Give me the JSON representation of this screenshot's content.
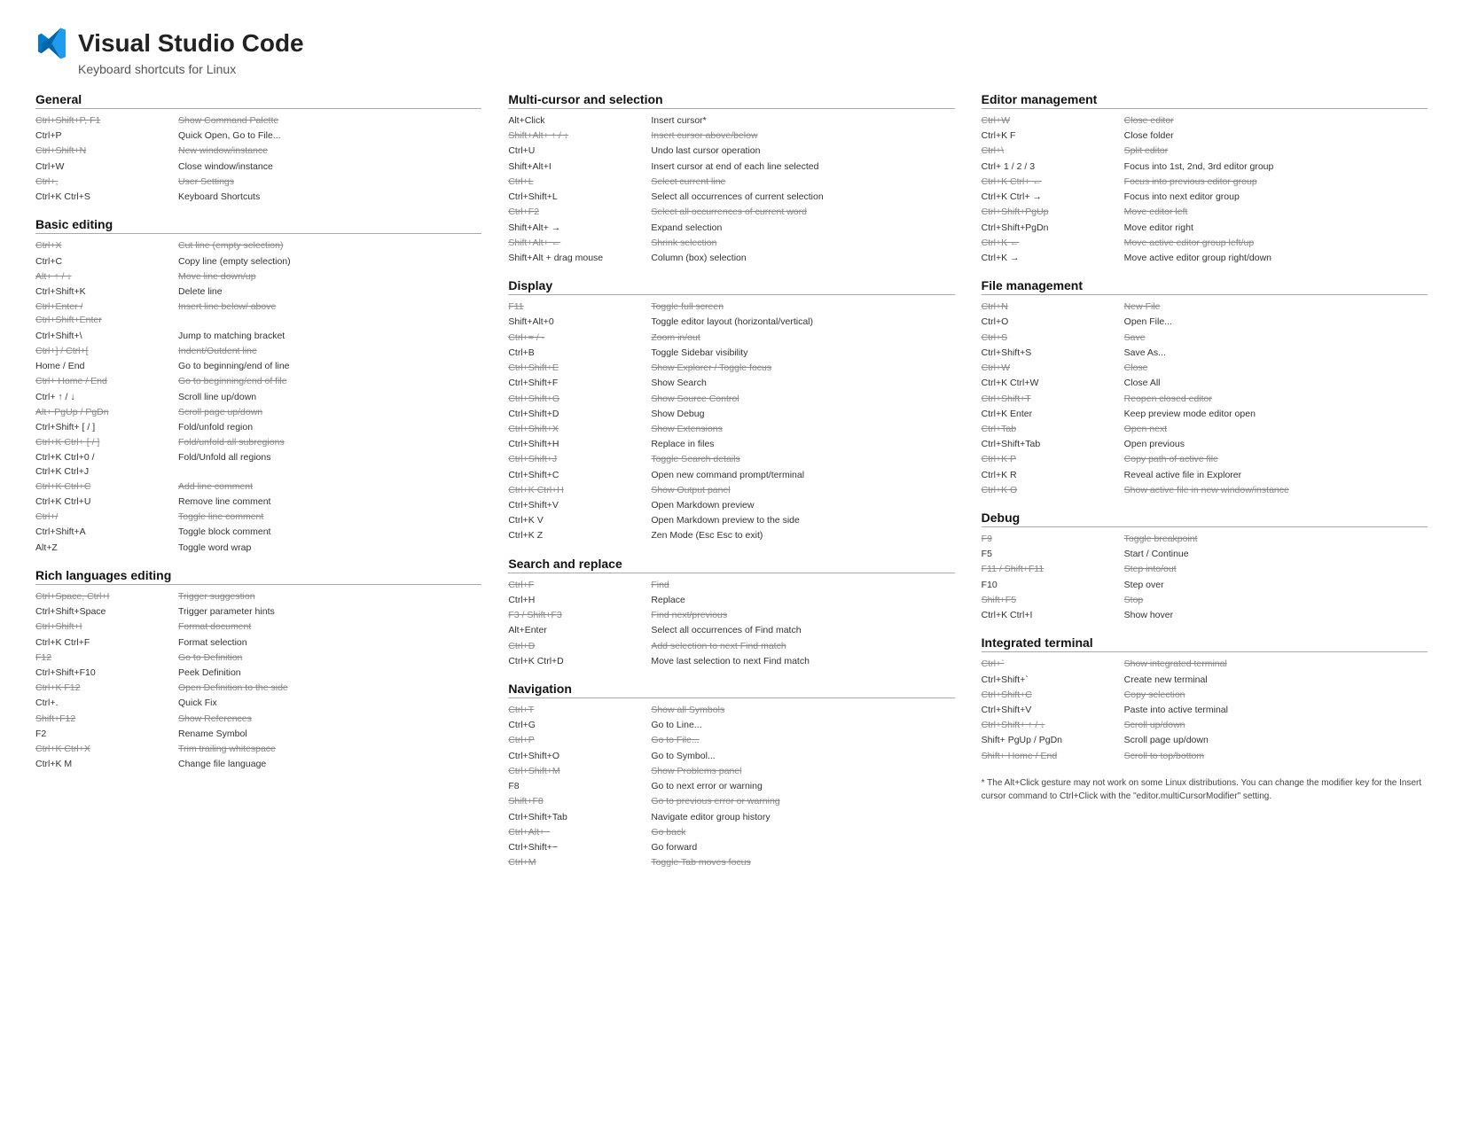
{
  "header": {
    "title": "Visual Studio Code",
    "subtitle": "Keyboard shortcuts for Linux"
  },
  "sections": {
    "general": {
      "title": "General",
      "items": [
        {
          "key": "Ctrl+Shift+P, F1",
          "desc": "Show Command Palette",
          "strike": true
        },
        {
          "key": "Ctrl+P",
          "desc": "Quick Open, Go to File..."
        },
        {
          "key": "Ctrl+Shift+N",
          "desc": "New window/instance",
          "strike": true
        },
        {
          "key": "Ctrl+W",
          "desc": "Close window/instance"
        },
        {
          "key": "Ctrl+,",
          "desc": "User Settings",
          "strike": true
        },
        {
          "key": "Ctrl+K Ctrl+S",
          "desc": "Keyboard Shortcuts"
        }
      ]
    },
    "basic_editing": {
      "title": "Basic editing",
      "items": [
        {
          "key": "Ctrl+X",
          "desc": "Cut line (empty selection)",
          "strike": true
        },
        {
          "key": "Ctrl+C",
          "desc": "Copy line (empty selection)"
        },
        {
          "key": "Alt+ ↑ / ↓",
          "desc": "Move line down/up",
          "strike": true
        },
        {
          "key": "Ctrl+Shift+K",
          "desc": "Delete line"
        },
        {
          "key": "Ctrl+Enter /\nCtrl+Shift+Enter",
          "desc": "Insert line below/ above",
          "strike": true
        },
        {
          "key": "Ctrl+Shift+\\",
          "desc": "Jump to matching bracket"
        },
        {
          "key": "Ctrl+] / Ctrl+[",
          "desc": "Indent/Outdent line",
          "strike": true
        },
        {
          "key": "Home / End",
          "desc": "Go to beginning/end of line"
        },
        {
          "key": "Ctrl+ Home / End",
          "desc": "Go to beginning/end of file",
          "strike": true
        },
        {
          "key": "Ctrl+ ↑ / ↓",
          "desc": "Scroll line up/down"
        },
        {
          "key": "Alt+ PgUp / PgDn",
          "desc": "Scroll page up/down",
          "strike": true
        },
        {
          "key": "Ctrl+Shift+ [ / ]",
          "desc": "Fold/unfold region"
        },
        {
          "key": "Ctrl+K Ctrl+ [ / ]",
          "desc": "Fold/unfold all subregions",
          "strike": true
        },
        {
          "key": "Ctrl+K Ctrl+0 /\nCtrl+K Ctrl+J",
          "desc": "Fold/Unfold all regions"
        },
        {
          "key": "Ctrl+K Ctrl+C",
          "desc": "Add line comment",
          "strike": true
        },
        {
          "key": "Ctrl+K Ctrl+U",
          "desc": "Remove line comment"
        },
        {
          "key": "Ctrl+/",
          "desc": "Toggle line comment",
          "strike": true
        },
        {
          "key": "Ctrl+Shift+A",
          "desc": "Toggle block comment"
        },
        {
          "key": "Alt+Z",
          "desc": "Toggle word wrap"
        }
      ]
    },
    "rich_languages": {
      "title": "Rich languages editing",
      "items": [
        {
          "key": "Ctrl+Space, Ctrl+I",
          "desc": "Trigger suggestion",
          "strike": true
        },
        {
          "key": "Ctrl+Shift+Space",
          "desc": "Trigger parameter hints"
        },
        {
          "key": "Ctrl+Shift+I",
          "desc": "Format document",
          "strike": true
        },
        {
          "key": "Ctrl+K Ctrl+F",
          "desc": "Format selection"
        },
        {
          "key": "F12",
          "desc": "Go to Definition",
          "strike": true
        },
        {
          "key": "Ctrl+Shift+F10",
          "desc": "Peek Definition"
        },
        {
          "key": "Ctrl+K F12",
          "desc": "Open Definition to the side",
          "strike": true
        },
        {
          "key": "Ctrl+.",
          "desc": "Quick Fix"
        },
        {
          "key": "Shift+F12",
          "desc": "Show References",
          "strike": true
        },
        {
          "key": "F2",
          "desc": "Rename Symbol"
        },
        {
          "key": "Ctrl+K Ctrl+X",
          "desc": "Trim trailing whitespace",
          "strike": true
        },
        {
          "key": "Ctrl+K M",
          "desc": "Change file language"
        }
      ]
    },
    "multi_cursor": {
      "title": "Multi-cursor and selection",
      "items": [
        {
          "key": "Alt+Click",
          "desc": "Insert cursor*"
        },
        {
          "key": "Shift+Alt+ ↑ / ↓",
          "desc": "Insert cursor above/below",
          "strike": true
        },
        {
          "key": "Ctrl+U",
          "desc": "Undo last cursor operation"
        },
        {
          "key": "Shift+Alt+I",
          "desc": "Insert cursor at end of each line selected"
        },
        {
          "key": "Ctrl+L",
          "desc": "Select current line",
          "strike": true
        },
        {
          "key": "Ctrl+Shift+L",
          "desc": "Select all occurrences of current selection"
        },
        {
          "key": "Ctrl+F2",
          "desc": "Select all occurrences of current word",
          "strike": true
        },
        {
          "key": "Shift+Alt+ →",
          "desc": "Expand selection"
        },
        {
          "key": "Shift+Alt+ ←",
          "desc": "Shrink selection",
          "strike": true
        },
        {
          "key": "Shift+Alt + drag mouse",
          "desc": "Column (box) selection"
        }
      ]
    },
    "display": {
      "title": "Display",
      "items": [
        {
          "key": "F11",
          "desc": "Toggle full screen",
          "strike": true
        },
        {
          "key": "Shift+Alt+0",
          "desc": "Toggle editor layout (horizontal/vertical)"
        },
        {
          "key": "Ctrl+= / -",
          "desc": "Zoom in/out",
          "strike": true
        },
        {
          "key": "Ctrl+B",
          "desc": "Toggle Sidebar visibility"
        },
        {
          "key": "Ctrl+Shift+E",
          "desc": "Show Explorer / Toggle focus",
          "strike": true
        },
        {
          "key": "Ctrl+Shift+F",
          "desc": "Show Search"
        },
        {
          "key": "Ctrl+Shift+G",
          "desc": "Show Source Control",
          "strike": true
        },
        {
          "key": "Ctrl+Shift+D",
          "desc": "Show Debug"
        },
        {
          "key": "Ctrl+Shift+X",
          "desc": "Show Extensions",
          "strike": true
        },
        {
          "key": "Ctrl+Shift+H",
          "desc": "Replace in files"
        },
        {
          "key": "Ctrl+Shift+J",
          "desc": "Toggle Search details",
          "strike": true
        },
        {
          "key": "Ctrl+Shift+C",
          "desc": "Open new command prompt/terminal"
        },
        {
          "key": "Ctrl+K Ctrl+H",
          "desc": "Show Output panel",
          "strike": true
        },
        {
          "key": "Ctrl+Shift+V",
          "desc": "Open Markdown preview"
        },
        {
          "key": "Ctrl+K V",
          "desc": "Open Markdown preview to the side"
        },
        {
          "key": "Ctrl+K Z",
          "desc": "Zen Mode (Esc Esc to exit)"
        }
      ]
    },
    "search_replace": {
      "title": "Search and replace",
      "items": [
        {
          "key": "Ctrl+F",
          "desc": "Find",
          "strike": true
        },
        {
          "key": "Ctrl+H",
          "desc": "Replace"
        },
        {
          "key": "F3 / Shift+F3",
          "desc": "Find next/previous",
          "strike": true
        },
        {
          "key": "Alt+Enter",
          "desc": "Select all occurrences of Find match"
        },
        {
          "key": "Ctrl+D",
          "desc": "Add selection to next Find match",
          "strike": true
        },
        {
          "key": "Ctrl+K Ctrl+D",
          "desc": "Move last selection to next Find match"
        }
      ]
    },
    "navigation": {
      "title": "Navigation",
      "items": [
        {
          "key": "Ctrl+T",
          "desc": "Show all Symbols",
          "strike": true
        },
        {
          "key": "Ctrl+G",
          "desc": "Go to Line..."
        },
        {
          "key": "Ctrl+P",
          "desc": "Go to File...",
          "strike": true
        },
        {
          "key": "Ctrl+Shift+O",
          "desc": "Go to Symbol..."
        },
        {
          "key": "Ctrl+Shift+M",
          "desc": "Show Problems panel",
          "strike": true
        },
        {
          "key": "F8",
          "desc": "Go to next error or warning"
        },
        {
          "key": "Shift+F8",
          "desc": "Go to previous error or warning",
          "strike": true
        },
        {
          "key": "Ctrl+Shift+Tab",
          "desc": "Navigate editor group history"
        },
        {
          "key": "Ctrl+Alt+−",
          "desc": "Go back",
          "strike": true
        },
        {
          "key": "Ctrl+Shift+−",
          "desc": "Go forward"
        },
        {
          "key": "Ctrl+M",
          "desc": "Toggle Tab moves focus",
          "strike": true
        }
      ]
    },
    "editor_management": {
      "title": "Editor management",
      "items": [
        {
          "key": "Ctrl+W",
          "desc": "Close editor",
          "strike": true
        },
        {
          "key": "Ctrl+K F",
          "desc": "Close folder"
        },
        {
          "key": "Ctrl+\\",
          "desc": "Split editor",
          "strike": true
        },
        {
          "key": "Ctrl+ 1 / 2 / 3",
          "desc": "Focus into 1st, 2nd, 3rd editor group"
        },
        {
          "key": "Ctrl+K Ctrl+ ←",
          "desc": "Focus into previous editor group",
          "strike": true
        },
        {
          "key": "Ctrl+K Ctrl+ →",
          "desc": "Focus into next editor group"
        },
        {
          "key": "Ctrl+Shift+PgUp",
          "desc": "Move editor left",
          "strike": true
        },
        {
          "key": "Ctrl+Shift+PgDn",
          "desc": "Move editor right"
        },
        {
          "key": "Ctrl+K ←",
          "desc": "Move active editor group left/up",
          "strike": true
        },
        {
          "key": "Ctrl+K →",
          "desc": "Move active editor group right/down"
        }
      ]
    },
    "file_management": {
      "title": "File management",
      "items": [
        {
          "key": "Ctrl+N",
          "desc": "New File",
          "strike": true
        },
        {
          "key": "Ctrl+O",
          "desc": "Open File..."
        },
        {
          "key": "Ctrl+S",
          "desc": "Save",
          "strike": true
        },
        {
          "key": "Ctrl+Shift+S",
          "desc": "Save As..."
        },
        {
          "key": "Ctrl+W",
          "desc": "Close",
          "strike": true
        },
        {
          "key": "Ctrl+K Ctrl+W",
          "desc": "Close All"
        },
        {
          "key": "Ctrl+Shift+T",
          "desc": "Reopen closed editor",
          "strike": true
        },
        {
          "key": "Ctrl+K Enter",
          "desc": "Keep preview mode editor open"
        },
        {
          "key": "Ctrl+Tab",
          "desc": "Open next",
          "strike": true
        },
        {
          "key": "Ctrl+Shift+Tab",
          "desc": "Open previous"
        },
        {
          "key": "Ctrl+K P",
          "desc": "Copy path of active file",
          "strike": true
        },
        {
          "key": "Ctrl+K R",
          "desc": "Reveal active file in Explorer"
        },
        {
          "key": "Ctrl+K O",
          "desc": "Show active file in new window/instance",
          "strike": true
        }
      ]
    },
    "debug": {
      "title": "Debug",
      "items": [
        {
          "key": "F9",
          "desc": "Toggle breakpoint",
          "strike": true
        },
        {
          "key": "F5",
          "desc": "Start / Continue"
        },
        {
          "key": "F11 / Shift+F11",
          "desc": "Step into/out",
          "strike": true
        },
        {
          "key": "F10",
          "desc": "Step over"
        },
        {
          "key": "Shift+F5",
          "desc": "Stop",
          "strike": true
        },
        {
          "key": "Ctrl+K Ctrl+I",
          "desc": "Show hover"
        }
      ]
    },
    "integrated_terminal": {
      "title": "Integrated terminal",
      "items": [
        {
          "key": "Ctrl+`",
          "desc": "Show integrated terminal",
          "strike": true
        },
        {
          "key": "Ctrl+Shift+`",
          "desc": "Create new terminal"
        },
        {
          "key": "Ctrl+Shift+C",
          "desc": "Copy selection",
          "strike": true
        },
        {
          "key": "Ctrl+Shift+V",
          "desc": "Paste into active terminal"
        },
        {
          "key": "Ctrl+Shift+ ↑ / ↓",
          "desc": "Scroll up/down",
          "strike": true
        },
        {
          "key": "Shift+ PgUp / PgDn",
          "desc": "Scroll page up/down"
        },
        {
          "key": "Shift+ Home / End",
          "desc": "Scroll to top/bottom",
          "strike": true
        }
      ]
    }
  },
  "footnote": "* The Alt+Click gesture may not work on some Linux distributions.\nYou can change the modifier key for the Insert cursor command to\nCtrl+Click with the \"editor.multiCursorModifier\" setting."
}
